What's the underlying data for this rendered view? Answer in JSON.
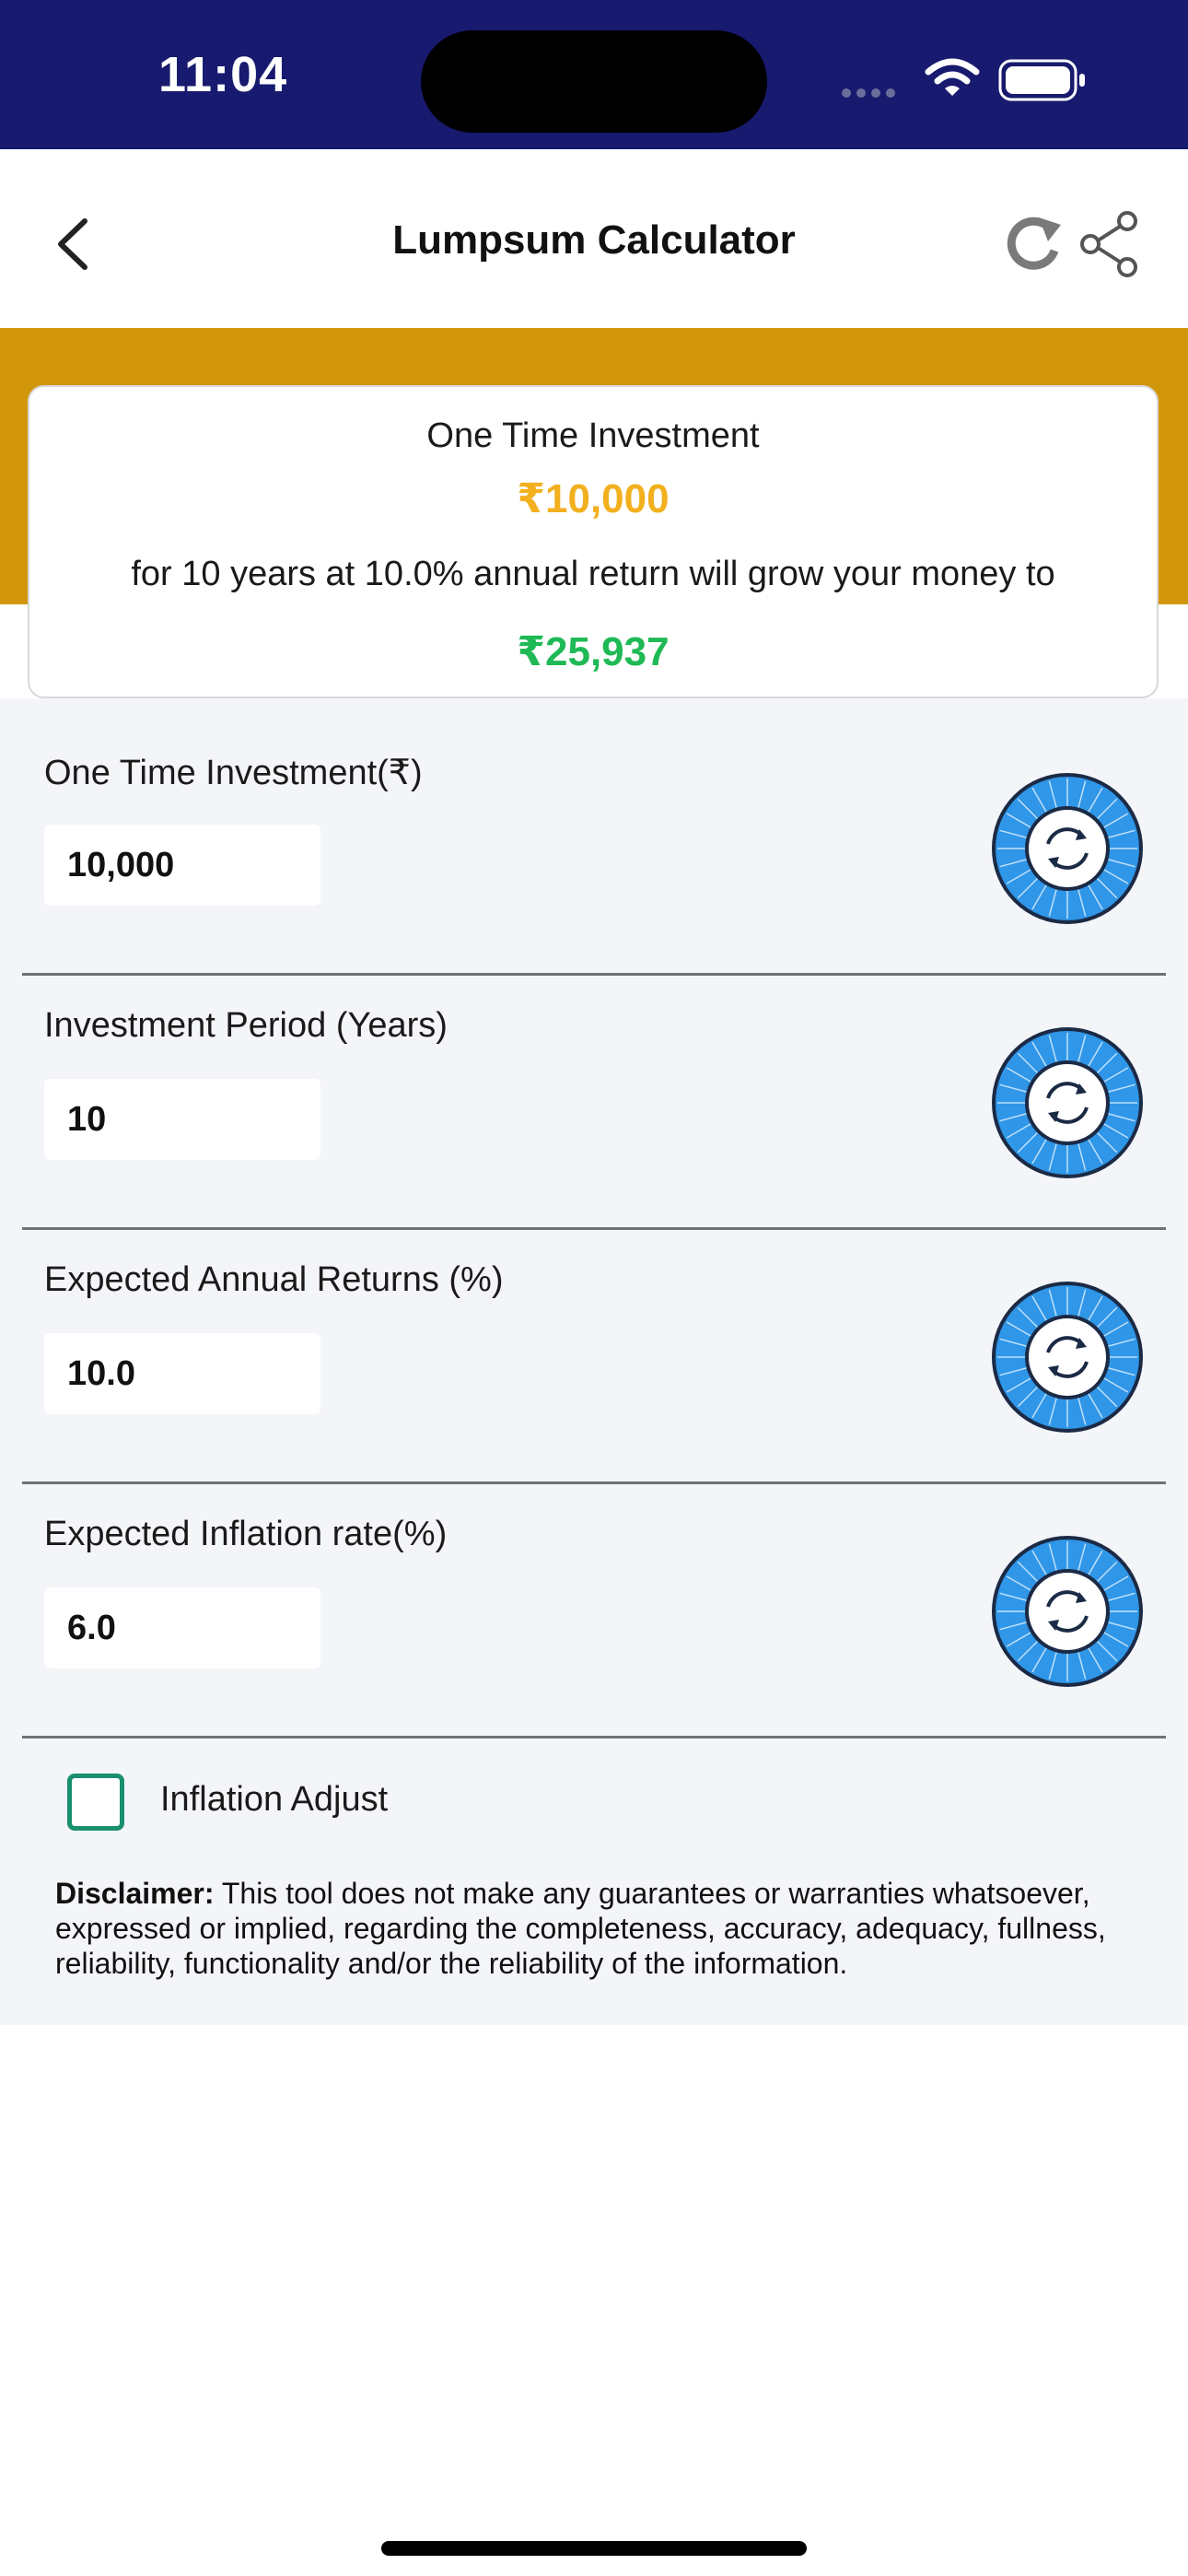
{
  "status_bar": {
    "time": "11:04"
  },
  "header": {
    "title": "Lumpsum Calculator"
  },
  "summary": {
    "label": "One Time Investment",
    "amount": "₹10,000",
    "description": "for 10 years at 10.0% annual return will grow your money to",
    "result": "₹25,937",
    "colors": {
      "amount": "#f2b01e",
      "result": "#1fb955",
      "band": "#d1960b"
    }
  },
  "fields": [
    {
      "label": "One Time Investment(₹)",
      "value": "10,000"
    },
    {
      "label": "Investment Period (Years)",
      "value": "10"
    },
    {
      "label": "Expected Annual Returns (%)",
      "value": "10.0"
    },
    {
      "label": "Expected Inflation rate(%)",
      "value": "6.0"
    }
  ],
  "inflation_adjust": {
    "label": "Inflation Adjust",
    "checked": false
  },
  "disclaimer": {
    "title": "Disclaimer:",
    "text": "This tool does not make any guarantees or warranties whatsoever, expressed or implied, regarding the completeness, accuracy, adequacy, fullness, reliability, functionality and/or the reliability of the information."
  },
  "icons": [
    "back-chevron-icon",
    "refresh-icon",
    "share-icon",
    "dial-icon",
    "wifi-icon",
    "battery-icon"
  ]
}
